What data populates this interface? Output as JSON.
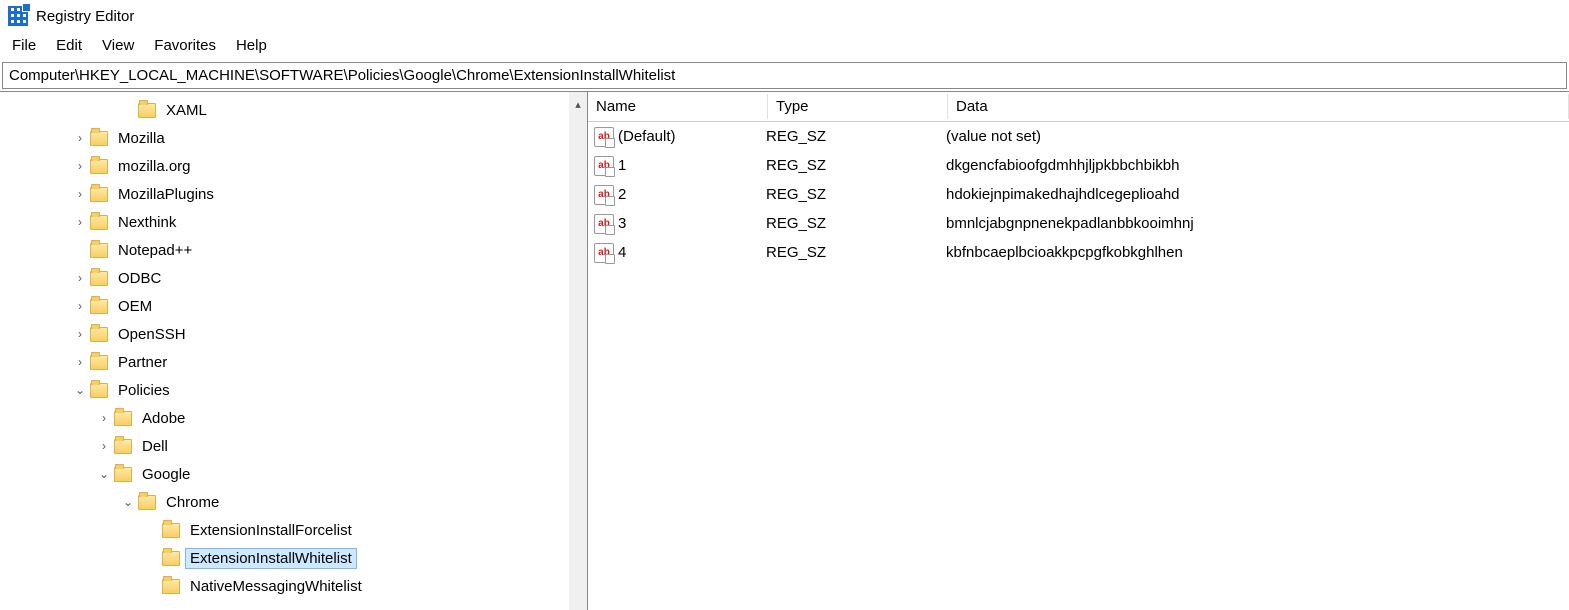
{
  "window": {
    "title": "Registry Editor"
  },
  "menu": {
    "file": "File",
    "edit": "Edit",
    "view": "View",
    "favorites": "Favorites",
    "help": "Help"
  },
  "address": "Computer\\HKEY_LOCAL_MACHINE\\SOFTWARE\\Policies\\Google\\Chrome\\ExtensionInstallWhitelist",
  "tree": [
    {
      "indent": 5,
      "exp": "",
      "label": "XAML",
      "line": "└"
    },
    {
      "indent": 3,
      "exp": ">",
      "label": "Mozilla"
    },
    {
      "indent": 3,
      "exp": ">",
      "label": "mozilla.org"
    },
    {
      "indent": 3,
      "exp": ">",
      "label": "MozillaPlugins"
    },
    {
      "indent": 3,
      "exp": ">",
      "label": "Nexthink"
    },
    {
      "indent": 3,
      "exp": "",
      "label": "Notepad++"
    },
    {
      "indent": 3,
      "exp": ">",
      "label": "ODBC"
    },
    {
      "indent": 3,
      "exp": ">",
      "label": "OEM"
    },
    {
      "indent": 3,
      "exp": ">",
      "label": "OpenSSH"
    },
    {
      "indent": 3,
      "exp": ">",
      "label": "Partner"
    },
    {
      "indent": 3,
      "exp": "v",
      "label": "Policies"
    },
    {
      "indent": 4,
      "exp": ">",
      "label": "Adobe"
    },
    {
      "indent": 4,
      "exp": ">",
      "label": "Dell"
    },
    {
      "indent": 4,
      "exp": "v",
      "label": "Google"
    },
    {
      "indent": 5,
      "exp": "v",
      "label": "Chrome"
    },
    {
      "indent": 6,
      "exp": "",
      "label": "ExtensionInstallForcelist"
    },
    {
      "indent": 6,
      "exp": "",
      "label": "ExtensionInstallWhitelist",
      "selected": true
    },
    {
      "indent": 6,
      "exp": "",
      "label": "NativeMessagingWhitelist"
    }
  ],
  "columns": {
    "name": "Name",
    "type": "Type",
    "data": "Data"
  },
  "values": [
    {
      "name": "(Default)",
      "type": "REG_SZ",
      "data": "(value not set)"
    },
    {
      "name": "1",
      "type": "REG_SZ",
      "data": "dkgencfabioofgdmhhjljpkbbchbikbh"
    },
    {
      "name": "2",
      "type": "REG_SZ",
      "data": "hdokiejnpimakedhajhdlcegeplioahd"
    },
    {
      "name": "3",
      "type": "REG_SZ",
      "data": "bmnlcjabgnpnenekpadlanbbkooimhnj"
    },
    {
      "name": "4",
      "type": "REG_SZ",
      "data": "kbfnbcaeplbcioakkpcpgfkobkghlhen"
    }
  ],
  "icon_text": "ab"
}
